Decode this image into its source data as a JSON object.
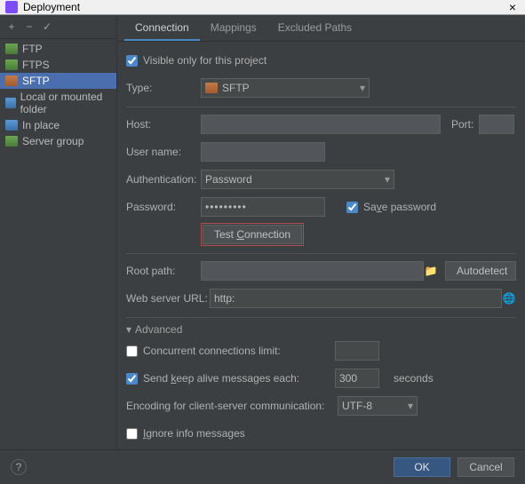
{
  "title": "Deployment",
  "close": "×",
  "sidebar": {
    "items": [
      {
        "label": "FTP"
      },
      {
        "label": "FTPS"
      },
      {
        "label": "SFTP"
      },
      {
        "label": "Local or mounted folder"
      },
      {
        "label": "In place"
      },
      {
        "label": "Server group"
      }
    ]
  },
  "tabs": {
    "connection": "Connection",
    "mappings": "Mappings",
    "excluded": "Excluded Paths"
  },
  "form": {
    "visible_only": "Visible only for this project",
    "type_label": "Type:",
    "type_value": "SFTP",
    "host_label": "Host:",
    "port_label": "Port:",
    "user_label": "User name:",
    "auth_label": "Authentication:",
    "auth_value": "Password",
    "password_label": "Password:",
    "password_value": "•••••••••",
    "save_password": "Save password",
    "test_connection": "Test Connection",
    "root_label": "Root path:",
    "autodetect": "Autodetect",
    "web_label": "Web server URL:",
    "web_value": "http:",
    "advanced": "Advanced",
    "concurrent": "Concurrent connections limit:",
    "keepalive": "Send keep alive messages each:",
    "keepalive_value": "300",
    "seconds": "seconds",
    "encoding_label": "Encoding for client-server communication:",
    "encoding_value": "UTF-8",
    "ignore_info": "Ignore info messages"
  },
  "footer": {
    "ok": "OK",
    "cancel": "Cancel",
    "help": "?"
  }
}
